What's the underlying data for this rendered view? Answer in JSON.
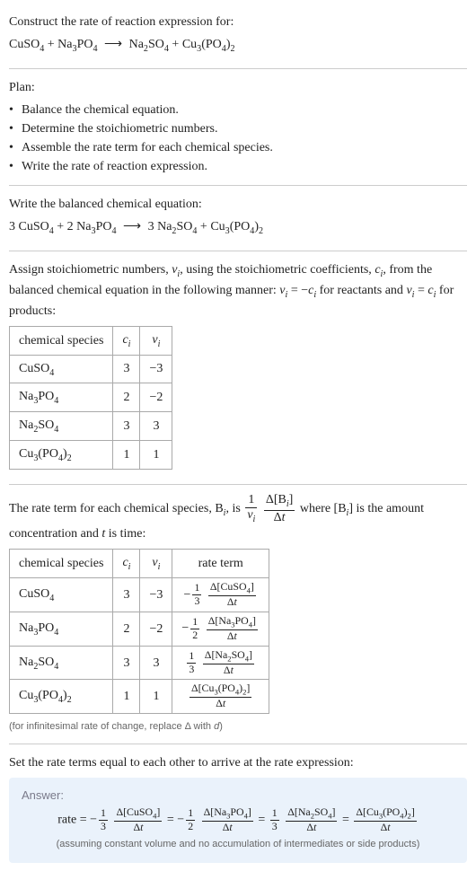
{
  "problem": {
    "prompt": "Construct the rate of reaction expression for:",
    "equation_html": "CuSO<span class='sub'>4</span> + Na<span class='sub'>3</span>PO<span class='sub'>4</span> <span class='arrow'>⟶</span> Na<span class='sub'>2</span>SO<span class='sub'>4</span> + Cu<span class='sub'>3</span>(PO<span class='sub'>4</span>)<span class='sub'>2</span>"
  },
  "plan": {
    "heading": "Plan:",
    "items": [
      "Balance the chemical equation.",
      "Determine the stoichiometric numbers.",
      "Assemble the rate term for each chemical species.",
      "Write the rate of reaction expression."
    ]
  },
  "balanced": {
    "heading": "Write the balanced chemical equation:",
    "equation_html": "3 CuSO<span class='sub'>4</span> + 2 Na<span class='sub'>3</span>PO<span class='sub'>4</span> <span class='arrow'>⟶</span> 3 Na<span class='sub'>2</span>SO<span class='sub'>4</span> + Cu<span class='sub'>3</span>(PO<span class='sub'>4</span>)<span class='sub'>2</span>"
  },
  "stoich": {
    "intro_html": "Assign stoichiometric numbers, <span class='ital'>ν<span class='sub'>i</span></span>, using the stoichiometric coefficients, <span class='ital'>c<span class='sub'>i</span></span>, from the balanced chemical equation in the following manner: <span class='ital'>ν<span class='sub'>i</span></span> = −<span class='ital'>c<span class='sub'>i</span></span> for reactants and <span class='ital'>ν<span class='sub'>i</span></span> = <span class='ital'>c<span class='sub'>i</span></span> for products:",
    "headers": {
      "species": "chemical species",
      "ci_html": "<span class='ital'>c<span class='sub'>i</span></span>",
      "vi_html": "<span class='ital'>ν<span class='sub'>i</span></span>"
    },
    "rows": [
      {
        "species_html": "CuSO<span class='sub'>4</span>",
        "ci": "3",
        "vi": "−3"
      },
      {
        "species_html": "Na<span class='sub'>3</span>PO<span class='sub'>4</span>",
        "ci": "2",
        "vi": "−2"
      },
      {
        "species_html": "Na<span class='sub'>2</span>SO<span class='sub'>4</span>",
        "ci": "3",
        "vi": "3"
      },
      {
        "species_html": "Cu<span class='sub'>3</span>(PO<span class='sub'>4</span>)<span class='sub'>2</span>",
        "ci": "1",
        "vi": "1"
      }
    ]
  },
  "rateterm_intro_html": "The rate term for each chemical species, B<span class='sub ital'>i</span>, is <span class='frac big'><span class='num'>1</span><span class='den ital'>ν<span class='sub'>i</span></span></span> <span class='frac big'><span class='num'>Δ[B<span class='sub ital'>i</span>]</span><span class='den'>Δ<span class='ital'>t</span></span></span> where [B<span class='sub ital'>i</span>] is the amount concentration and <span class='ital'>t</span> is time:",
  "ratetable": {
    "headers": {
      "species": "chemical species",
      "ci_html": "<span class='ital'>c<span class='sub'>i</span></span>",
      "vi_html": "<span class='ital'>ν<span class='sub'>i</span></span>",
      "rate": "rate term"
    },
    "rows": [
      {
        "species_html": "CuSO<span class='sub'>4</span>",
        "ci": "3",
        "vi": "−3",
        "rate_html": "<span class='rateterm'>−<span class='frac'><span class='num'>1</span><span class='den'>3</span></span> <span class='frac'><span class='num'>Δ[CuSO<span class='sub'>4</span>]</span><span class='den'>Δ<span class='ital'>t</span></span></span></span>"
      },
      {
        "species_html": "Na<span class='sub'>3</span>PO<span class='sub'>4</span>",
        "ci": "2",
        "vi": "−2",
        "rate_html": "<span class='rateterm'>−<span class='frac'><span class='num'>1</span><span class='den'>2</span></span> <span class='frac'><span class='num'>Δ[Na<span class='sub'>3</span>PO<span class='sub'>4</span>]</span><span class='den'>Δ<span class='ital'>t</span></span></span></span>"
      },
      {
        "species_html": "Na<span class='sub'>2</span>SO<span class='sub'>4</span>",
        "ci": "3",
        "vi": "3",
        "rate_html": "<span class='rateterm'><span class='frac'><span class='num'>1</span><span class='den'>3</span></span> <span class='frac'><span class='num'>Δ[Na<span class='sub'>2</span>SO<span class='sub'>4</span>]</span><span class='den'>Δ<span class='ital'>t</span></span></span></span>"
      },
      {
        "species_html": "Cu<span class='sub'>3</span>(PO<span class='sub'>4</span>)<span class='sub'>2</span>",
        "ci": "1",
        "vi": "1",
        "rate_html": "<span class='rateterm'><span class='frac'><span class='num'>Δ[Cu<span class='sub'>3</span>(PO<span class='sub'>4</span>)<span class='sub'>2</span>]</span><span class='den'>Δ<span class='ital'>t</span></span></span></span>"
      }
    ],
    "note_html": "(for infinitesimal rate of change, replace Δ with <span class='ital'>d</span>)"
  },
  "final_intro": "Set the rate terms equal to each other to arrive at the rate expression:",
  "answer": {
    "label": "Answer:",
    "expr_html": "rate = −<span class='frac'><span class='num'>1</span><span class='den'>3</span></span> <span class='frac'><span class='num'>Δ[CuSO<span class='sub'>4</span>]</span><span class='den'>Δ<span class='ital'>t</span></span></span> = −<span class='frac'><span class='num'>1</span><span class='den'>2</span></span> <span class='frac'><span class='num'>Δ[Na<span class='sub'>3</span>PO<span class='sub'>4</span>]</span><span class='den'>Δ<span class='ital'>t</span></span></span> = <span class='frac'><span class='num'>1</span><span class='den'>3</span></span> <span class='frac'><span class='num'>Δ[Na<span class='sub'>2</span>SO<span class='sub'>4</span>]</span><span class='den'>Δ<span class='ital'>t</span></span></span> = <span class='frac'><span class='num'>Δ[Cu<span class='sub'>3</span>(PO<span class='sub'>4</span>)<span class='sub'>2</span>]</span><span class='den'>Δ<span class='ital'>t</span></span></span>",
    "note": "(assuming constant volume and no accumulation of intermediates or side products)"
  }
}
